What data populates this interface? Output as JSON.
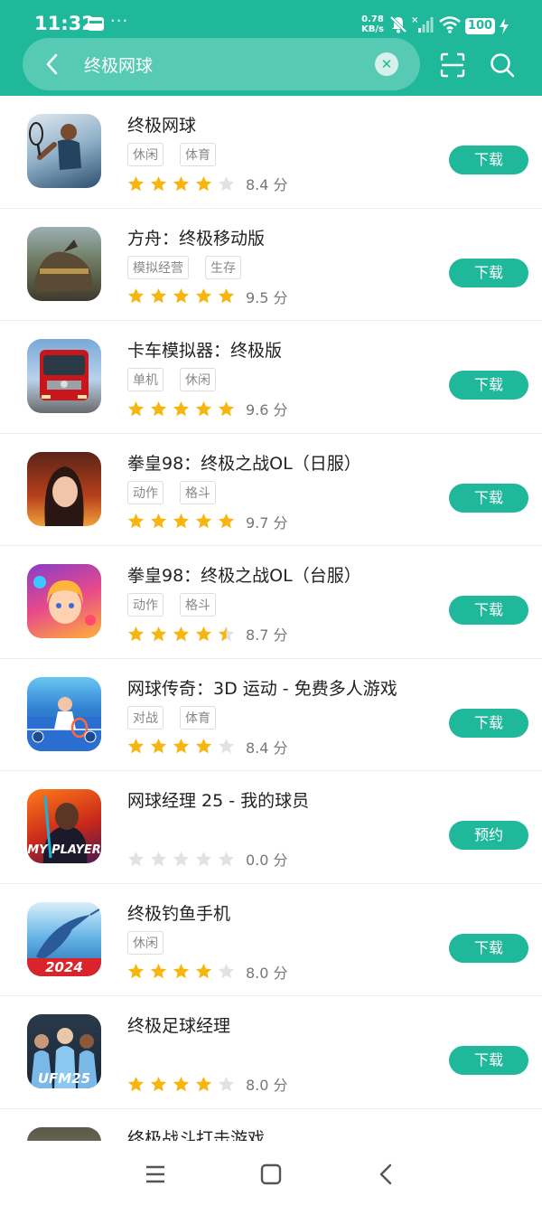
{
  "status_bar": {
    "time": "11:32",
    "dots": "···",
    "speed_value": "0.78",
    "speed_unit": "KB/s",
    "battery": "100"
  },
  "search": {
    "query": "终极网球",
    "clear_icon": "close-icon"
  },
  "colors": {
    "accent": "#1fb89a",
    "star_filled": "#f6b60f",
    "star_empty": "#e2e2e2"
  },
  "apps": [
    {
      "title": "终极网球",
      "tags": [
        "休闲",
        "体育"
      ],
      "stars": 4,
      "score": "8.4 分",
      "button": "下载"
    },
    {
      "title": "方舟：终极移动版",
      "tags": [
        "模拟经营",
        "生存"
      ],
      "stars": 5,
      "score": "9.5 分",
      "button": "下载"
    },
    {
      "title": "卡车模拟器：终极版",
      "tags": [
        "单机",
        "休闲"
      ],
      "stars": 5,
      "score": "9.6 分",
      "button": "下载"
    },
    {
      "title": "拳皇98：终极之战OL（日服）",
      "tags": [
        "动作",
        "格斗"
      ],
      "stars": 5,
      "score": "9.7 分",
      "button": "下载"
    },
    {
      "title": "拳皇98：终极之战OL（台服）",
      "tags": [
        "动作",
        "格斗"
      ],
      "stars": 4.5,
      "score": "8.7 分",
      "button": "下载"
    },
    {
      "title": "网球传奇：3D 运动 - 免费多人游戏",
      "tags": [
        "对战",
        "体育"
      ],
      "stars": 4,
      "score": "8.4 分",
      "button": "下载"
    },
    {
      "title": "网球经理 25 - 我的球员",
      "tags": [],
      "stars": 0,
      "score": "0.0 分",
      "button": "预约",
      "icon_text": "MY PLAYER"
    },
    {
      "title": "终极钓鱼手机",
      "tags": [
        "休闲"
      ],
      "stars": 4,
      "score": "8.0 分",
      "button": "下载",
      "icon_text": "2024"
    },
    {
      "title": "终极足球经理",
      "tags": [],
      "stars": 4,
      "score": "8.0 分",
      "button": "下载",
      "icon_text": "UFM25"
    },
    {
      "title": "终极战斗打击游戏",
      "tags": [],
      "stars": 0,
      "score": "",
      "button": ""
    }
  ],
  "nav": {
    "menu_icon": "menu-icon",
    "home_icon": "home-icon",
    "back_icon": "back-icon"
  }
}
